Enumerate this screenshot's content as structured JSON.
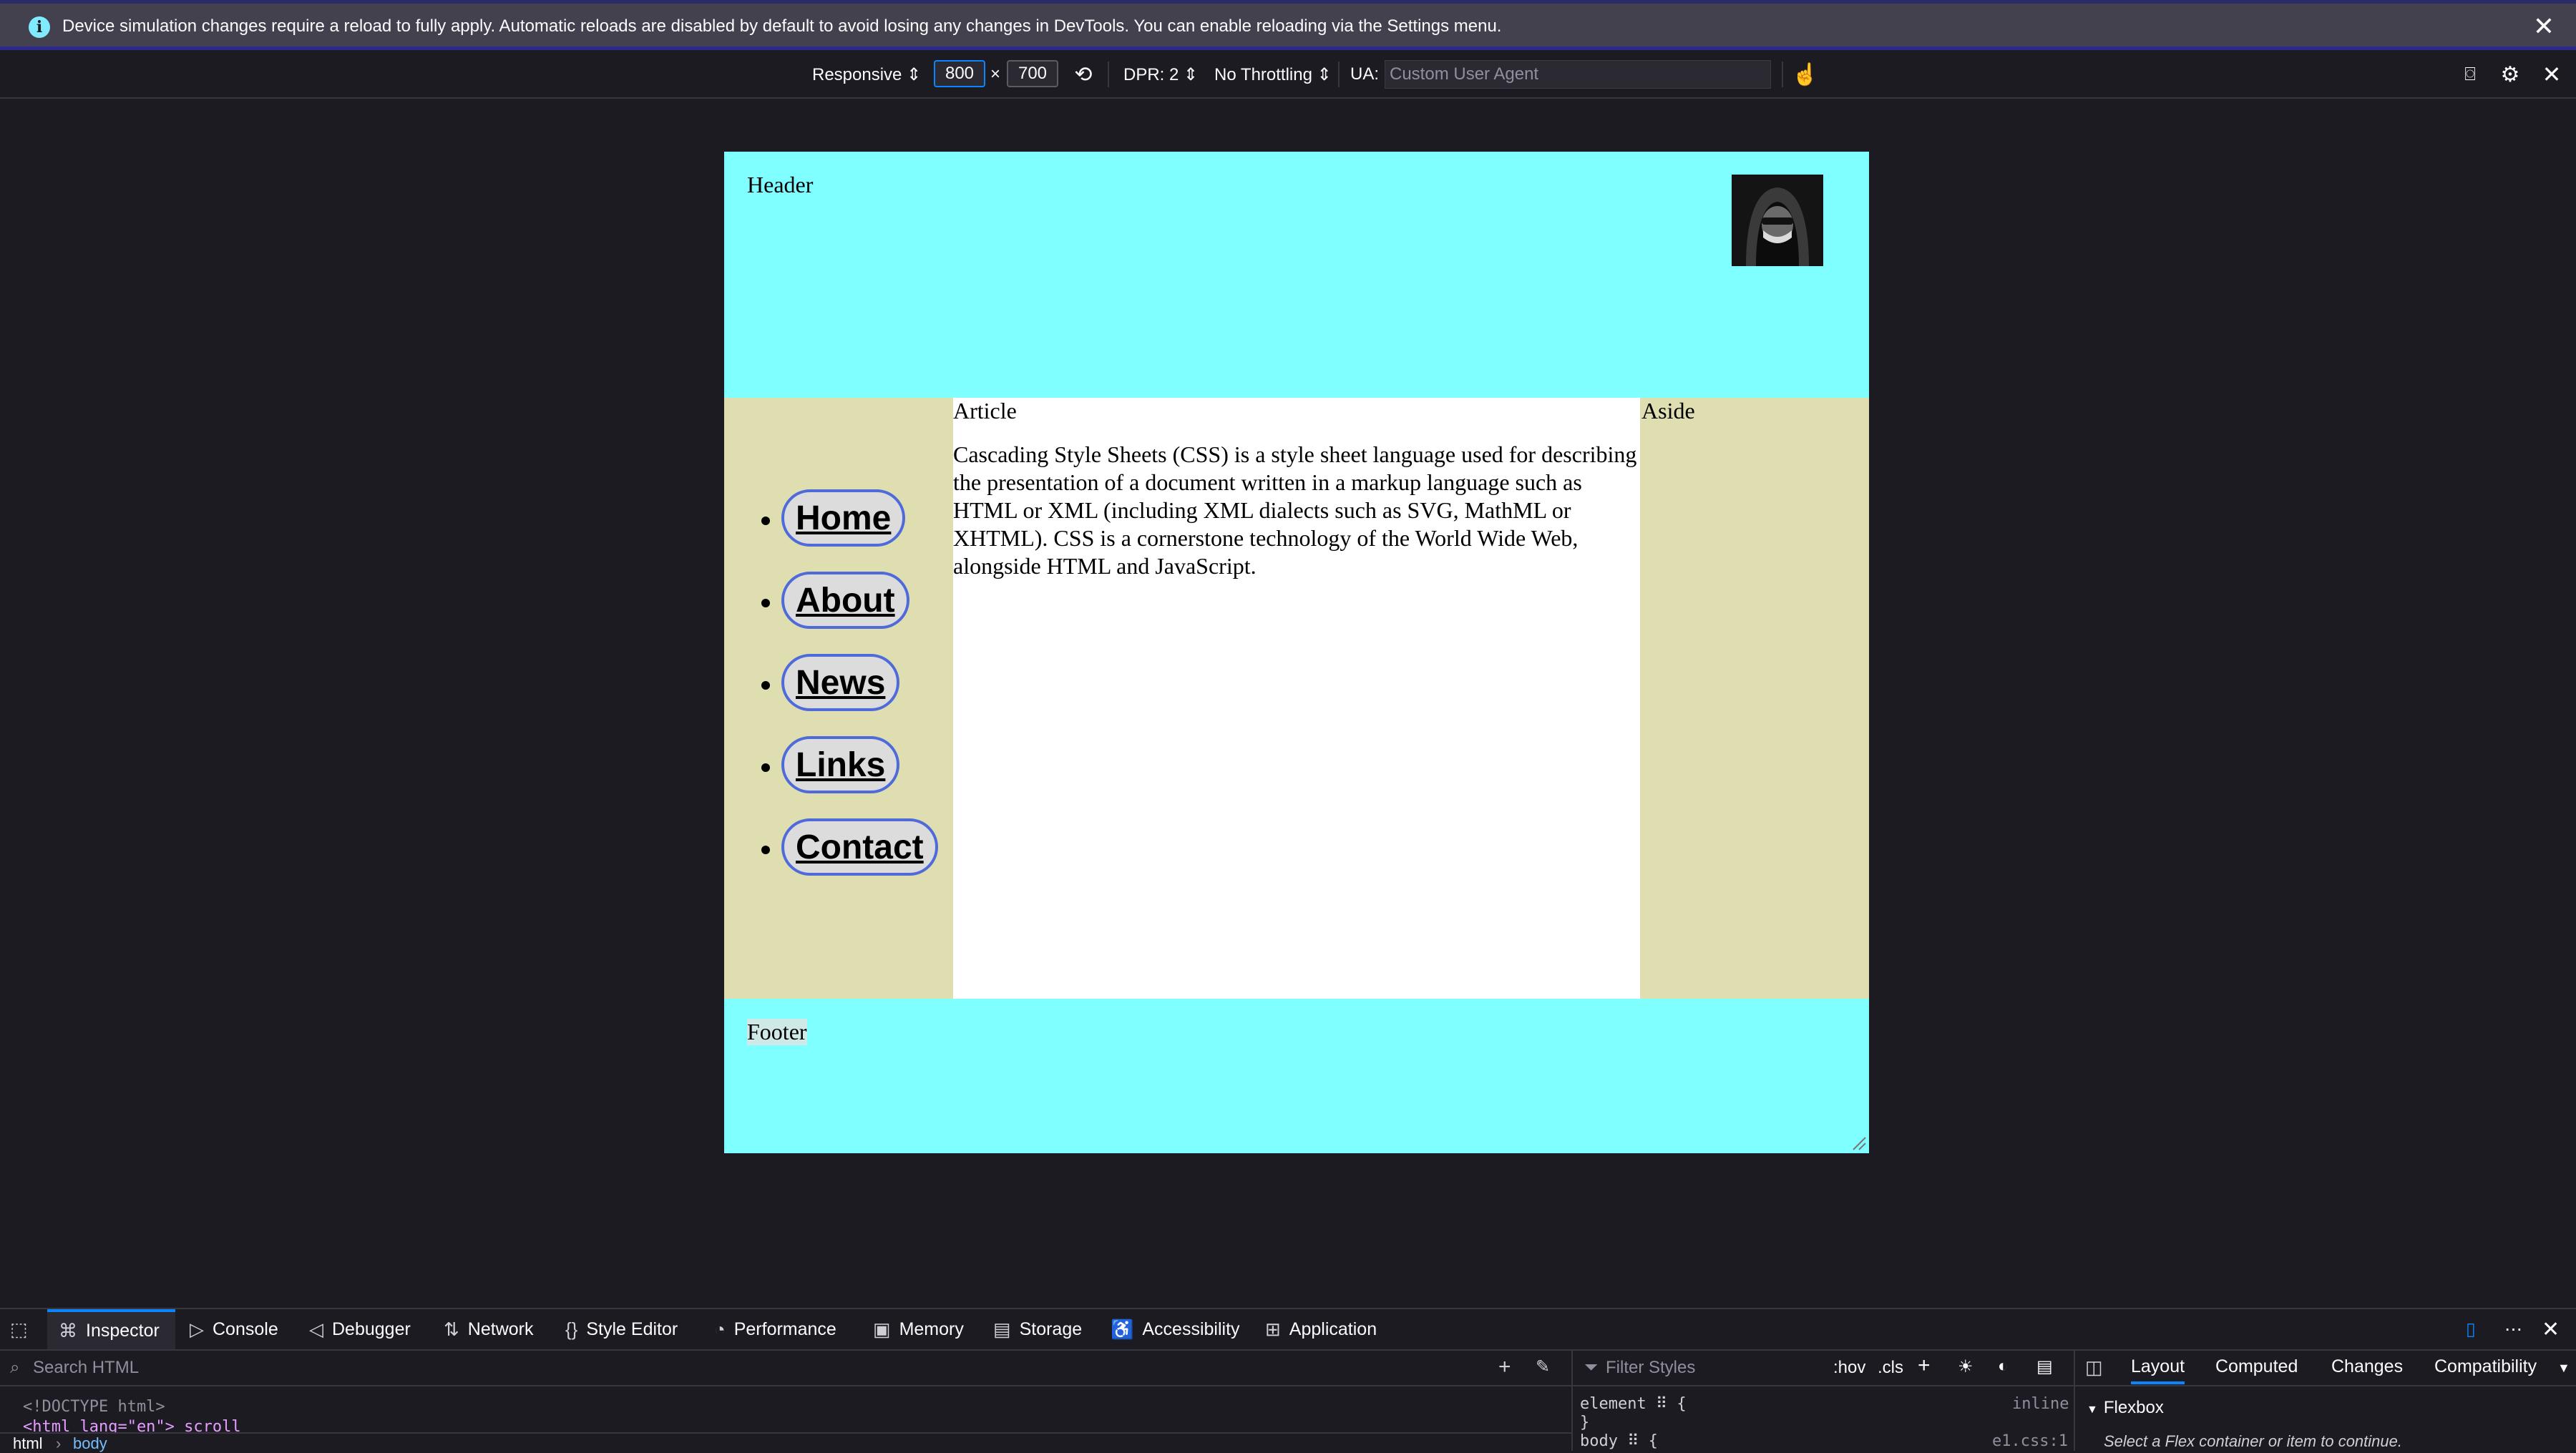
{
  "notification": {
    "message": "Device simulation changes require a reload to fully apply. Automatic reloads are disabled by default to avoid losing any changes in DevTools. You can enable reloading via the Settings menu.",
    "info_icon": "info-icon",
    "close_icon": "close-icon"
  },
  "rdm_toolbar": {
    "device": "Responsive ⇕",
    "width": "800",
    "times": "×",
    "height": "700",
    "dpr": "DPR: 2 ⇕",
    "throttling": "No Throttling ⇕",
    "ua_label": "UA:",
    "ua_placeholder": "Custom User Agent"
  },
  "page": {
    "header": "Header",
    "nav_items": [
      "Home",
      "About",
      "News",
      "Links",
      "Contact"
    ],
    "article_title": "Article",
    "article_text": "Cascading Style Sheets (CSS) is a style sheet language used for describing the presentation of a document written in a markup language such as HTML or XML (including XML dialects such as SVG, MathML or XHTML). CSS is a cornerstone technology of the World Wide Web, alongside HTML and JavaScript.",
    "aside_title": "Aside",
    "footer": "Footer",
    "colors": {
      "header_footer": "#7fffff",
      "sidebars": "#dfdeb1",
      "nav_border": "#4f6ad9"
    }
  },
  "devtools": {
    "tabs": [
      "Inspector",
      "Console",
      "Debugger",
      "Network",
      "Style Editor",
      "Performance",
      "Memory",
      "Storage",
      "Accessibility",
      "Application"
    ],
    "selected_tab": "Inspector",
    "search_html_placeholder": "Search HTML",
    "markup_lines": [
      "<!DOCTYPE html>",
      "<html lang=\"en\"> scroll"
    ],
    "breadcrumb": [
      "html",
      "body"
    ],
    "filter_styles_placeholder": "Filter Styles",
    "hov": ":hov",
    "cls": ".cls",
    "rule_element": "element ⠿ {",
    "rule_close": "}",
    "rule_inline": "inline",
    "rule_body": "body ⠿ {",
    "rule_body_src": "e1.css:1",
    "right_tabs": [
      "Layout",
      "Computed",
      "Changes",
      "Compatibility"
    ],
    "right_selected": "Layout",
    "flexbox_label": "Flexbox",
    "flexbox_hint": "Select a Flex container or item to continue."
  }
}
